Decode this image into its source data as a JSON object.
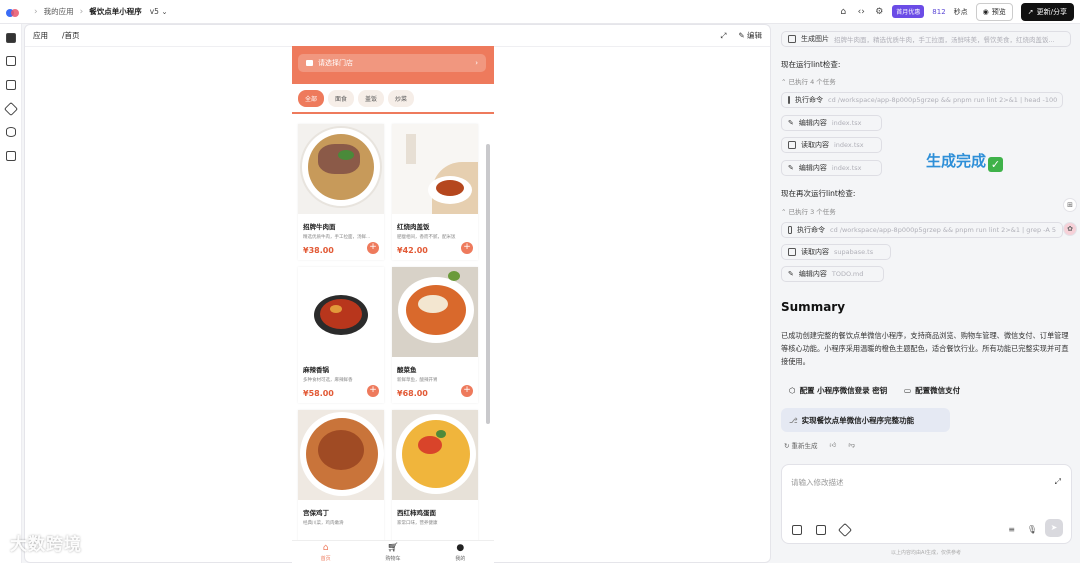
{
  "topbar": {
    "breadcrumb_root": "我的应用",
    "breadcrumb_app": "餐饮点单小程序",
    "version": "v5",
    "badge": "首月优惠",
    "count": "812",
    "seconds": "秒点",
    "preview": "预览",
    "share": "更新/分享"
  },
  "frame": {
    "tab_app": "应用",
    "tab_path": "/首页",
    "edit": "编辑"
  },
  "phone": {
    "store_label": "请选择门店",
    "categories": [
      "全部",
      "面食",
      "盖饭",
      "炒菜"
    ],
    "dishes": [
      {
        "name": "招牌牛肉面",
        "desc": "精选优质牛肉，手工拉面，汤鲜...",
        "price": "¥38.00"
      },
      {
        "name": "红烧肉盖饭",
        "desc": "肥瘦相间，香而不腻，配米饭",
        "price": "¥42.00"
      },
      {
        "name": "麻辣香锅",
        "desc": "多种食材可选，麻辣鲜香",
        "price": "¥58.00"
      },
      {
        "name": "酸菜鱼",
        "desc": "新鲜草鱼，酸辣开胃",
        "price": "¥68.00"
      },
      {
        "name": "宫保鸡丁",
        "desc": "经典川菜，鸡肉嫩滑",
        "price": ""
      },
      {
        "name": "西红柿鸡蛋面",
        "desc": "家常口味，营养健康",
        "price": ""
      }
    ],
    "tabbar": [
      "首页",
      "购物车",
      "我的"
    ]
  },
  "panel": {
    "gen_image": {
      "label": "生成图片",
      "sub": "招牌牛肉面，精选优质牛肉，手工拉面，汤鲜味美，餐饮美食，红烧肉盖饭..."
    },
    "lint_title": "现在运行lint检查:",
    "lint_meta": "已执行 4 个任务",
    "lint_steps": [
      {
        "label": "执行命令",
        "sub": "cd /workspace/app-8p000p5grzep && pnpm run lint 2>&1 | head -100"
      },
      {
        "label": "编辑内容",
        "sub": "index.tsx"
      },
      {
        "label": "读取内容",
        "sub": "index.tsx"
      },
      {
        "label": "编辑内容",
        "sub": "index.tsx"
      }
    ],
    "relint_title": "现在再次运行lint检查:",
    "relint_meta": "已执行 3 个任务",
    "relint_steps": [
      {
        "label": "执行命令",
        "sub": "cd /workspace/app-8p000p5grzep && pnpm run lint 2>&1 | grep -A 5"
      },
      {
        "label": "读取内容",
        "sub": "supabase.ts"
      },
      {
        "label": "编辑内容",
        "sub": "TODO.md"
      }
    ],
    "done_text": "生成完成",
    "summary_title": "Summary",
    "summary_body": "已成功创建完整的餐饮点单微信小程序，支持商品浏览、购物车管理、微信支付、订单管理等核心功能。小程序采用温暖的橙色主题配色，适合餐饮行业。所有功能已完整实现并可直接使用。",
    "action1": "配置 小程序微信登录 密钥",
    "action2": "配置微信支付",
    "commit": "实现餐饮点单微信小程序完整功能",
    "regen": "重新生成",
    "input_placeholder": "请输入修改描述",
    "footnote": "以上内容均由AI生成，仅供参考",
    "watermark": "大数跨境"
  }
}
